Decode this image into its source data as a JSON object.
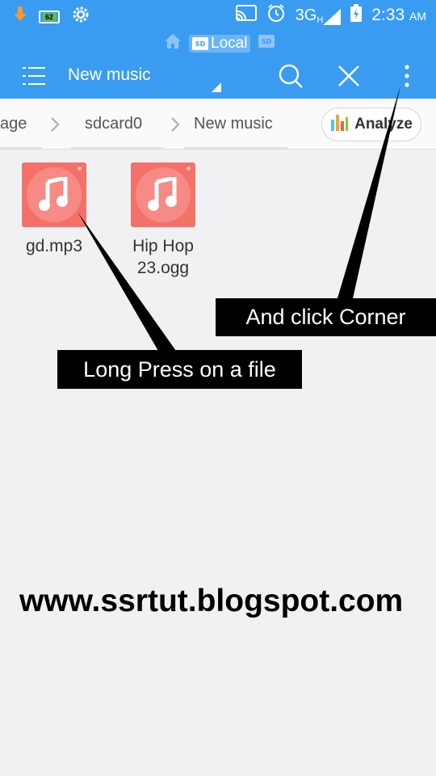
{
  "status_bar": {
    "battery_level": "62",
    "network": "3G",
    "network_sup": "H",
    "time": "2:33",
    "ampm": "AM",
    "icons": [
      "download-icon",
      "battery-icon",
      "settings-icon",
      "cast-icon",
      "alarm-icon",
      "signal-icon",
      "battery-charging-icon"
    ]
  },
  "location": {
    "label": "Local"
  },
  "toolbar": {
    "title": "New music"
  },
  "breadcrumb": {
    "items": [
      "age",
      "sdcard0",
      "New music"
    ],
    "analyze_label": "Analyze"
  },
  "files": [
    {
      "name": "gd.mp3"
    },
    {
      "name": "Hip Hop 23.ogg"
    }
  ],
  "callouts": {
    "corner": "And click Corner",
    "long_press": "Long Press on a file"
  },
  "watermark": "www.ssrtut.blogspot.com",
  "colors": {
    "accent": "#3a9cf0",
    "file_icon": "#f4716a",
    "background": "#f0f1f3"
  }
}
